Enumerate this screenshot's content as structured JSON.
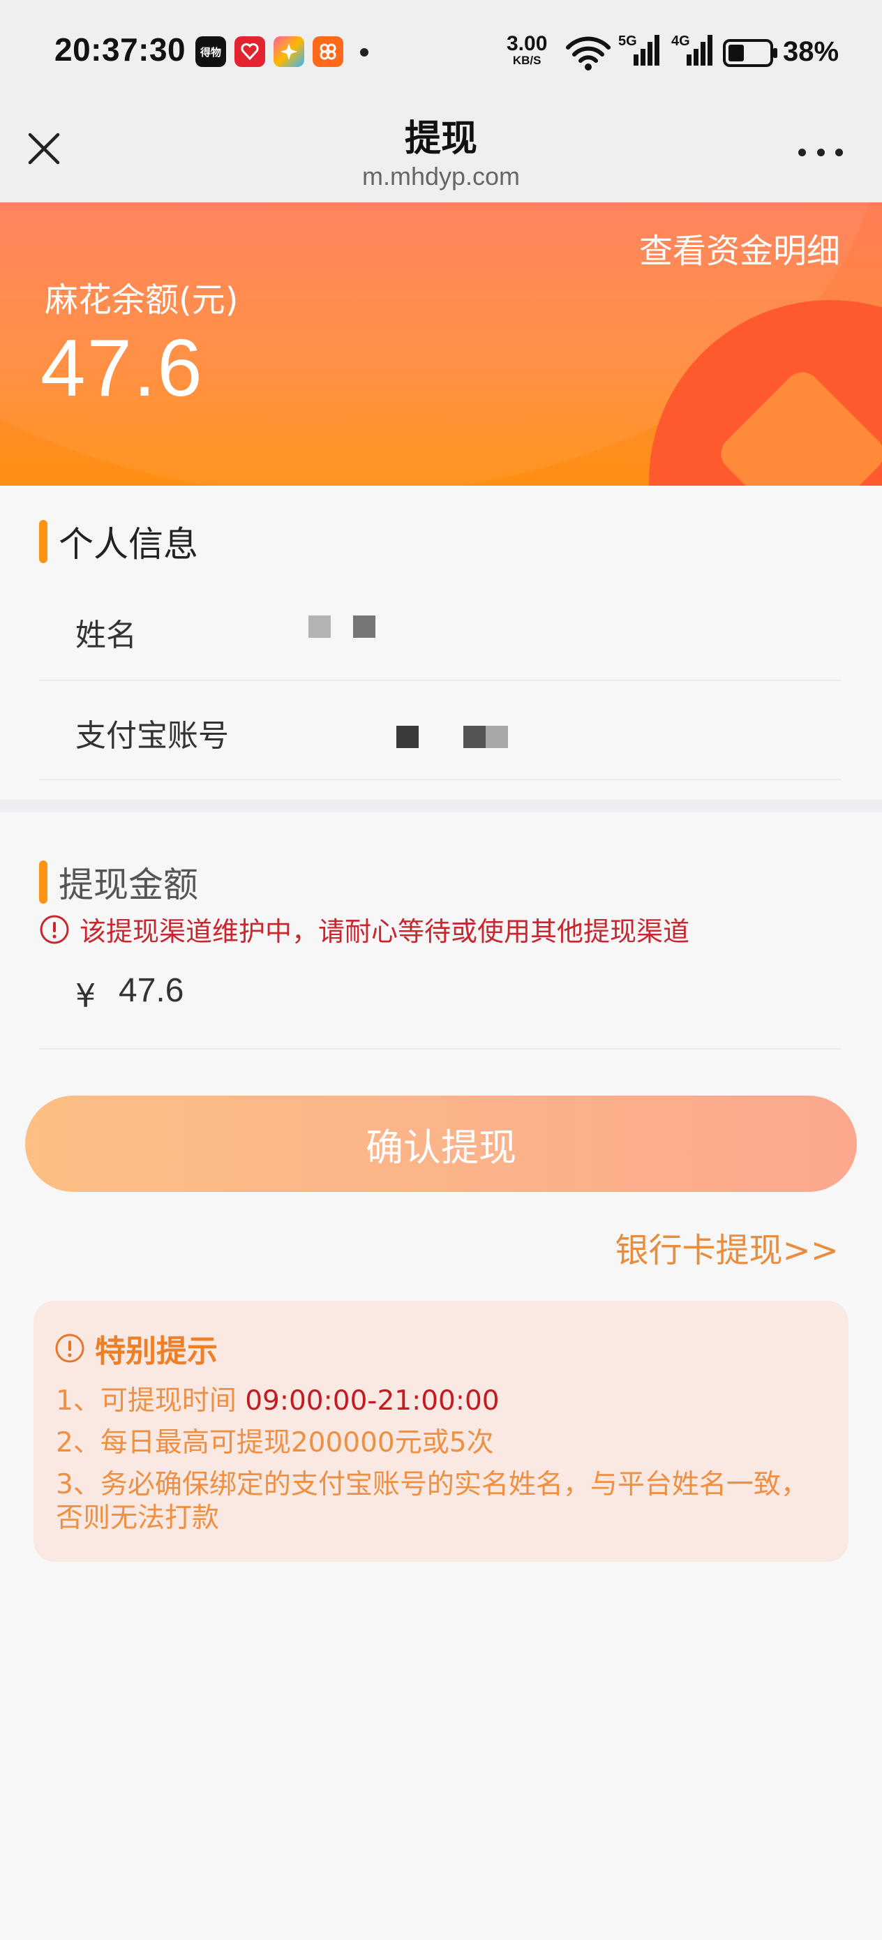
{
  "status_bar": {
    "time": "20:37:30",
    "app_icons": [
      {
        "name": "app-icon-1",
        "text": "得物",
        "color": "#111111"
      },
      {
        "name": "app-icon-2",
        "text": "",
        "color": "#e3232f"
      },
      {
        "name": "app-icon-3",
        "text": "",
        "color": "#7b61ff"
      },
      {
        "name": "app-icon-4",
        "text": "",
        "color": "#ff6a1a"
      }
    ],
    "net_speed_value": "3.00",
    "net_speed_unit": "KB/S",
    "signal_5g": "5G",
    "signal_4g": "4G",
    "battery": "38%"
  },
  "nav": {
    "title": "提现",
    "url": "m.mhdyp.com"
  },
  "banner": {
    "funds_detail_link": "查看资金明细",
    "balance_label": "麻花余额(元)",
    "balance_value": "47.6"
  },
  "personal_info": {
    "title": "个人信息",
    "name_label": "姓名",
    "alipay_label": "支付宝账号"
  },
  "withdraw_amount": {
    "title": "提现金额",
    "warning": "该提现渠道维护中，请耐心等待或使用其他提现渠道",
    "currency": "¥",
    "amount": "47.6"
  },
  "actions": {
    "confirm_label": "确认提现",
    "bank_card_link": "银行卡提现>>"
  },
  "notice": {
    "title": "特别提示",
    "line1_prefix": "1、可提现时间 ",
    "line1_time": "09:00:00-21:00:00",
    "line2": "2、每日最高可提现200000元或5次",
    "line3": "3、务必确保绑定的支付宝账号的实名姓名，与平台姓名一致，否则无法打款"
  },
  "colors": {
    "accent_orange": "#ff9318",
    "warning_red": "#c8272f",
    "button_gradient_start": "#fdbf84",
    "button_gradient_end": "#fba88e"
  }
}
